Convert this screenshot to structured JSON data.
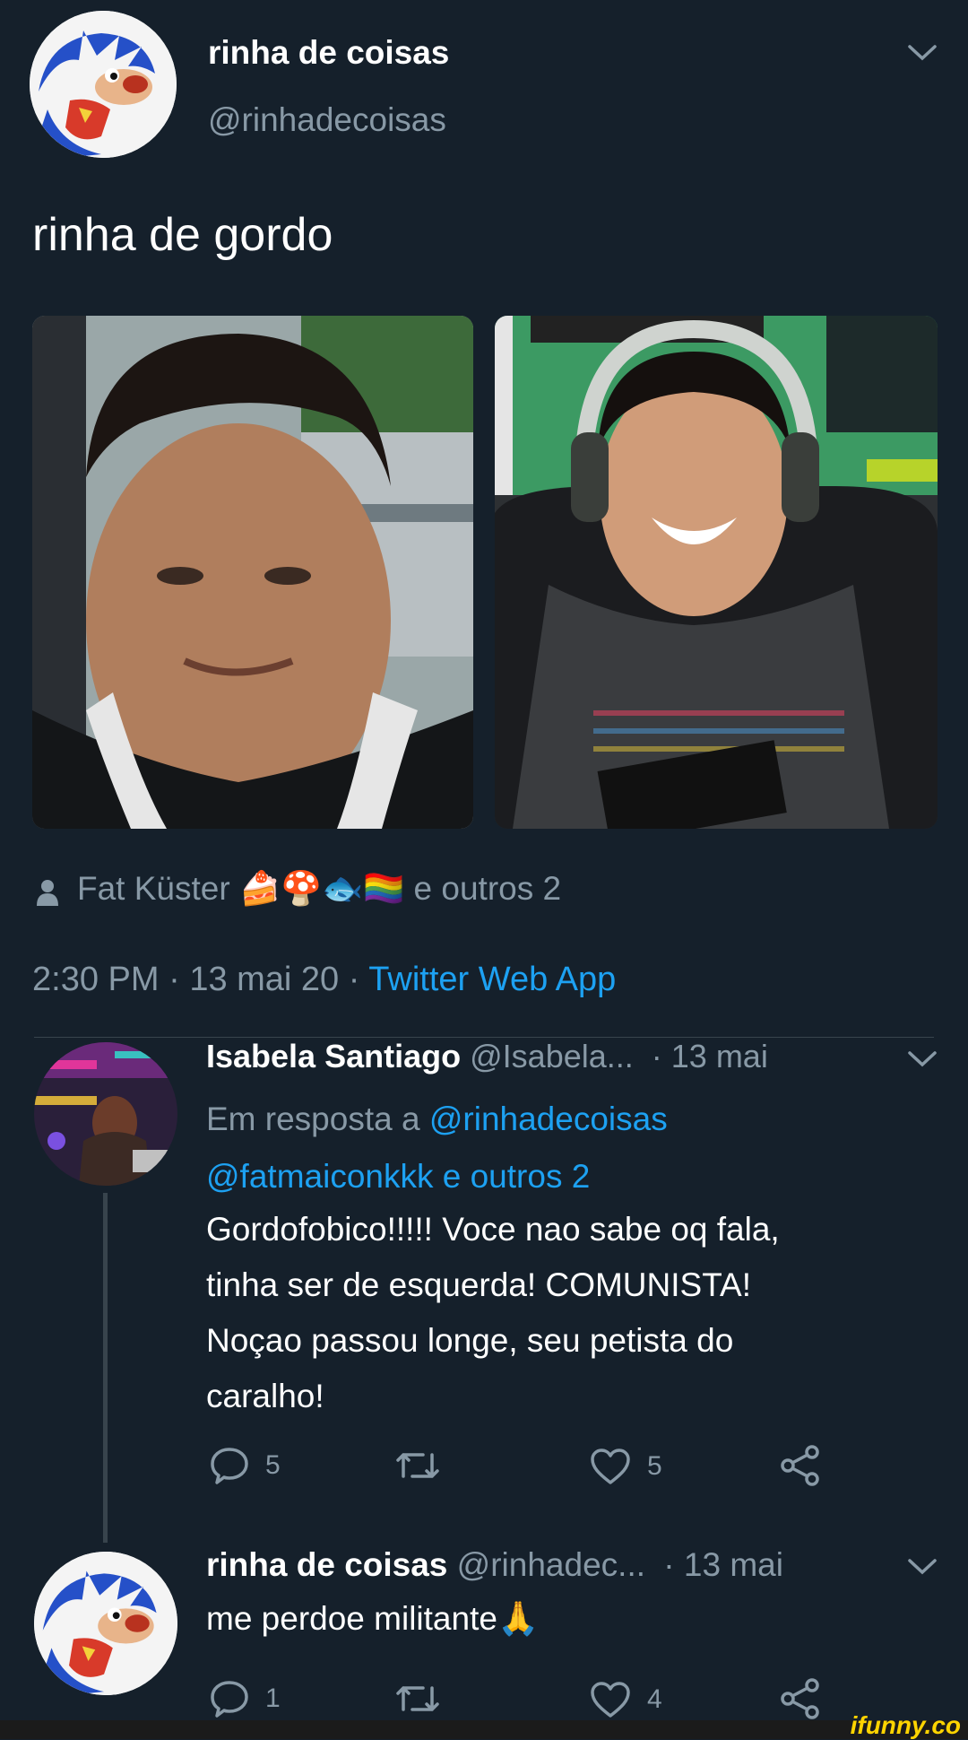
{
  "tweet": {
    "author_name": "rinha de coisas",
    "author_handle": "@rinhadecoisas",
    "text": "rinha de gordo",
    "tagged": {
      "name": "Fat Küster",
      "emoji": "🍰🍄🐟🏳️‍🌈",
      "suffix": "e outros 2"
    },
    "meta": {
      "time": "2:30 PM",
      "sep1": " · ",
      "date": "13 mai 20",
      "sep2": " · ",
      "source": "Twitter Web App"
    }
  },
  "replies": [
    {
      "name": "Isabela Santiago",
      "handle": "@Isabela...",
      "date": "· 13 mai",
      "reply_to_prefix": "Em resposta a",
      "reply_to_user": "@rinhadecoisas",
      "reply_to_more": "@fatmaiconkkk e outros 2",
      "text_lines": [
        "Gordofobico!!!!! Voce nao sabe oq fala,",
        "tinha ser de esquerda! COMUNISTA!",
        "Noçao passou longe, seu petista do",
        "caralho!"
      ],
      "replies_count": "5",
      "likes_count": "5"
    },
    {
      "name": "rinha de coisas",
      "handle": "@rinhadec...",
      "date": "· 13 mai",
      "text": "me perdoe militante",
      "emoji": "🙏",
      "replies_count": "1",
      "likes_count": "4"
    }
  ],
  "watermark": "ifunny.co",
  "colors": {
    "background": "#15202b",
    "secondary_text": "#8899a6",
    "link": "#1da1f2"
  }
}
